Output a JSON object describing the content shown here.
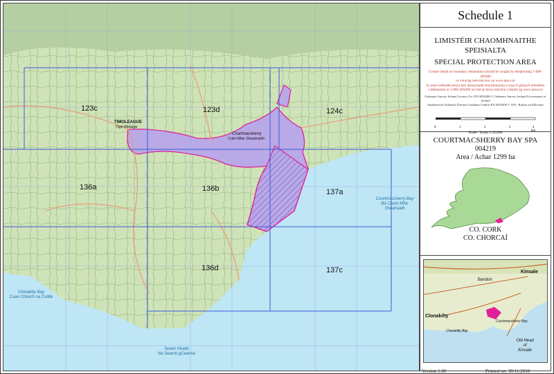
{
  "legend": {
    "title": "Schedule 1",
    "irish_1": "LIMISTÉIR CHAOMHNAITHE",
    "irish_2": "SPEISIALTA",
    "english": "SPECIAL PROTECTION AREA",
    "note_1": "Greater detail on boundary delineation should be sought by telephoning 1-800-405000",
    "note_2": "or viewing relevant text on www.npws.ie",
    "note_3": "Is ceart tuilleadh sonraí faoi dhreachadh teorainneacha a lorg trí ghlaoch teileafóin",
    "note_4": "a dhéanamh ar 1-800-405000 nó tríd an téacs iomchuí a léamh ag www.npws.ie",
    "licence_1": "Ordnance Survey Ireland Licence No. EN 0059208 © Ordnance Survey Ireland/Government of Ireland",
    "licence_2": "Suirbhéarcht Ordanáis Éireann Ceadúnas Uimhir EN 0059208 © OSI / Rialtas na hÉireann",
    "scale_ticks": [
      "0",
      "1",
      "2",
      "3",
      "4 km"
    ],
    "scale_label": "Scale / Scála 1:35,000",
    "site_name": "COURTMACSHERRY BAY SPA",
    "site_code": "004219",
    "area": "Area / Achar 1299 ha",
    "county_en": "CO. CORK",
    "county_ga": "CO. CHORCAÍ",
    "version": "Version 1.00",
    "printed": "Printed on: 30/11/2010"
  },
  "map": {
    "sheets": [
      "123c",
      "123d",
      "124c",
      "136a",
      "136b",
      "137a",
      "136d",
      "137c"
    ],
    "places": {
      "timoleague": "TIMOLEAGUE",
      "timoleague_ga": "Tigh Molaige",
      "courtmacsherry": "Courtmacsherry",
      "courtmacsherry_ga": "Cúirt Mhic Shéafraidh",
      "bay_en": "Courtmacsherry Bay",
      "bay_ga": "Bá Chúirt Mhic Shéafraidh",
      "clonakilty_bay_en": "Clonakilty Bay",
      "clonakilty_bay_ga": "Cuan Chloich na Coillte",
      "seven_heads_en": "Seven Heads",
      "seven_heads_ga": "Na Seacht gCeanna"
    }
  },
  "locator": {
    "kinsale": "Kinsale",
    "clonakilty": "Clonakilty",
    "bandon": "Bandon",
    "old_head_1": "Old Head",
    "old_head_2": "of",
    "old_head_3": "Kinsale",
    "clonakilty_bay": "Clonakilty Bay",
    "courtmacsherry_bay": "Courtmacsherry Bay"
  },
  "colors": {
    "land": "#cfe3b8",
    "sea": "#bfe6f5",
    "spa_fill": "#b9a9e6",
    "spa_border": "#e0209a",
    "grid": "#3a5bd8",
    "hatch": "#6a52c8"
  }
}
